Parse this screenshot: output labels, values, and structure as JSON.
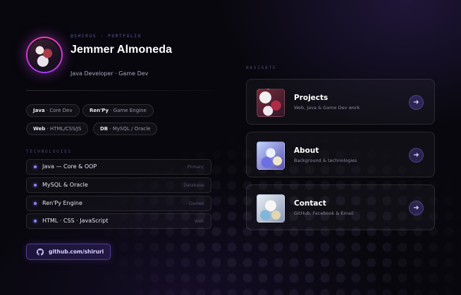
{
  "profile": {
    "handle": "@SHIRUS · PORTFOLIO",
    "name": "Jemmer Almoneda",
    "role": "Java Developer · Game Dev"
  },
  "tags": [
    {
      "key": "Java",
      "value": "· Core Dev"
    },
    {
      "key": "Ren'Py",
      "value": "· Game Engine"
    },
    {
      "key": "Web",
      "value": "· HTML/CSS/JS"
    },
    {
      "key": "DB",
      "value": "· MySQL / Oracle"
    }
  ],
  "technologies": {
    "label": "TECHNOLOGIES",
    "items": [
      {
        "name": "Java — Core & OOP",
        "category": "Primary"
      },
      {
        "name": "MySQL & Oracle",
        "category": "Database"
      },
      {
        "name": "Ren'Py Engine",
        "category": "Games"
      },
      {
        "name": "HTML · CSS · JavaScript",
        "category": "Web"
      }
    ]
  },
  "github": {
    "label": "github.com/shiruri",
    "icon": "github-icon"
  },
  "navigate": {
    "label": "NAVIGATE",
    "cards": [
      {
        "title": "Projects",
        "subtitle": "Web, Java & Game Dev work",
        "icon": "arrow-right-icon"
      },
      {
        "title": "About",
        "subtitle": "Background & technologies",
        "icon": "arrow-right-icon"
      },
      {
        "title": "Contact",
        "subtitle": "GitHub, Facebook & Email",
        "icon": "arrow-right-icon"
      }
    ]
  }
}
